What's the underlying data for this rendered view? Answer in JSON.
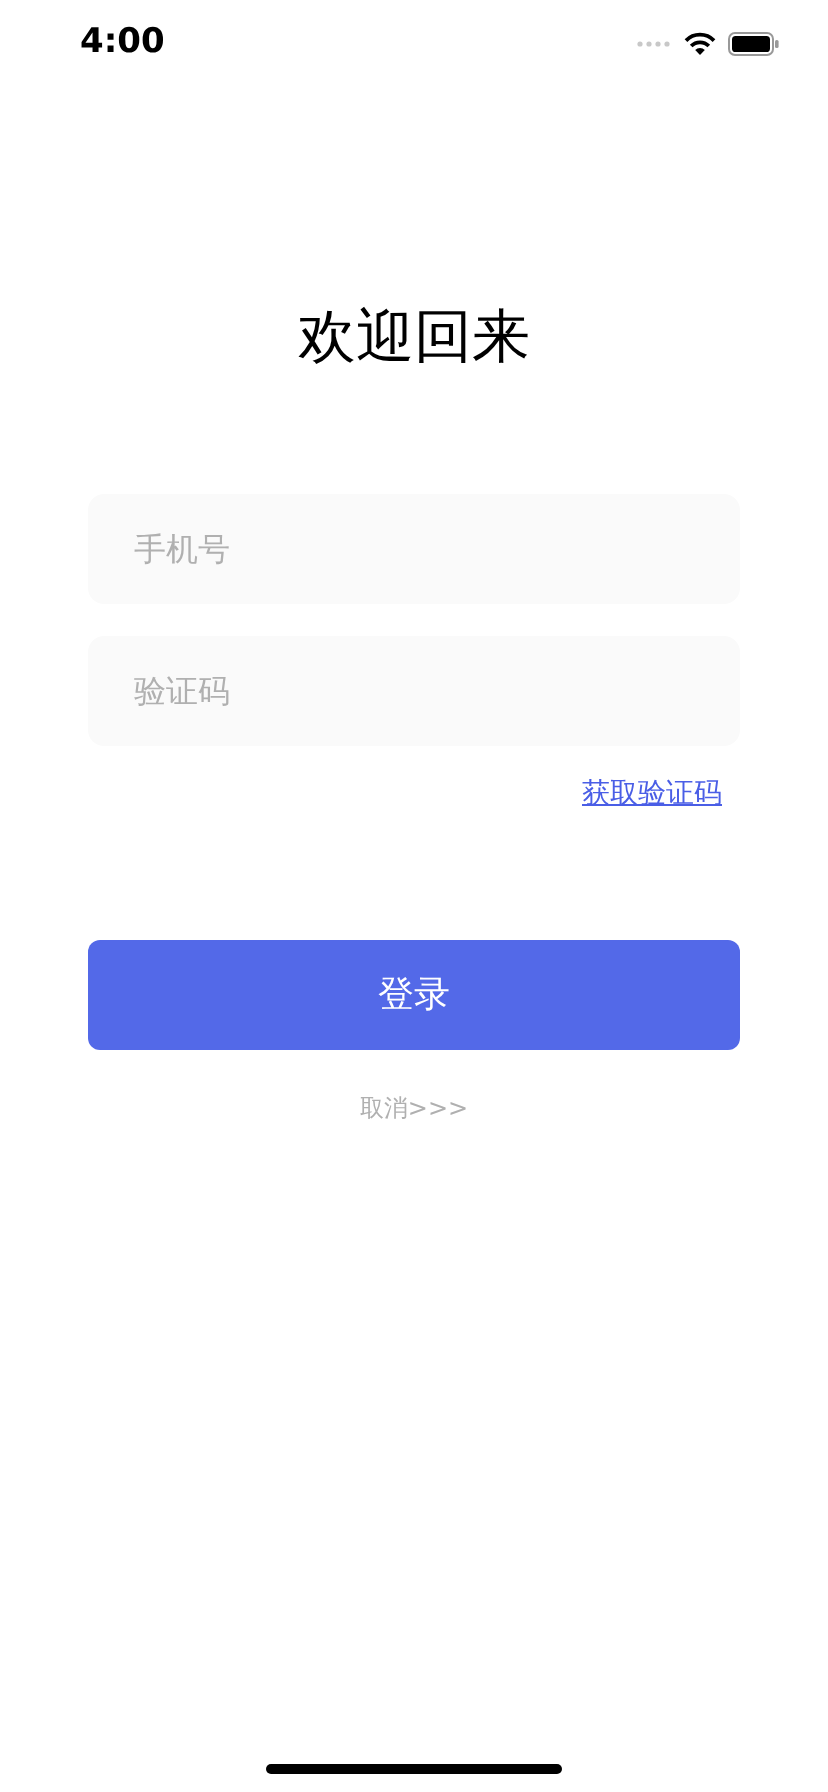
{
  "status_bar": {
    "time": "4:00"
  },
  "title": "欢迎回来",
  "fields": [
    {
      "placeholder": "手机号"
    },
    {
      "placeholder": "验证码"
    }
  ],
  "get_code_link": "获取验证码",
  "login_button": "登录",
  "cancel_link": "取消>>>"
}
